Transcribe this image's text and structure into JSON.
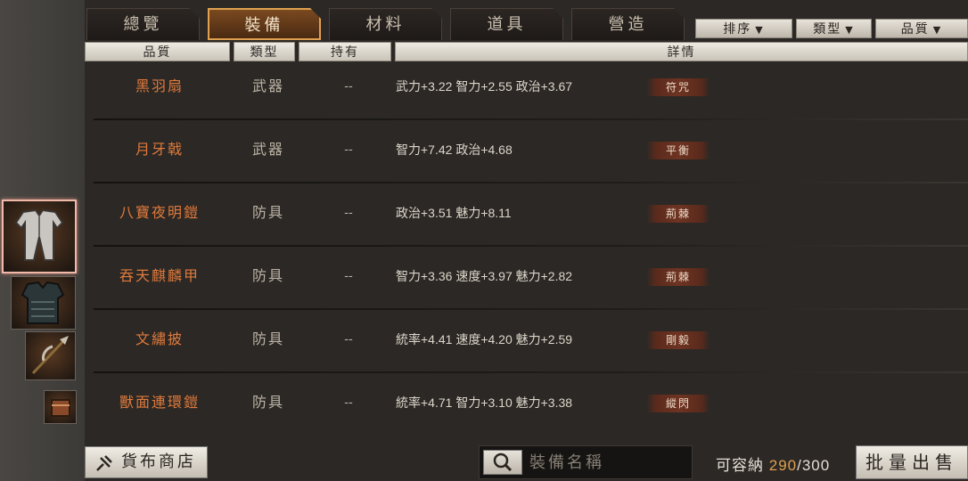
{
  "tabs": [
    {
      "label": "總覽"
    },
    {
      "label": "裝備"
    },
    {
      "label": "材料"
    },
    {
      "label": "道具"
    },
    {
      "label": "營造"
    }
  ],
  "active_tab": "裝備",
  "sort_buttons": {
    "sort": "排序",
    "type": "類型",
    "quality": "品質",
    "arrow": "▼"
  },
  "columns": {
    "quality": "品質",
    "type": "類型",
    "owned": "持有",
    "details": "詳情"
  },
  "items": [
    {
      "name": "黑羽扇",
      "type": "武器",
      "owned": "--",
      "stats": "武力+3.22 智力+2.55 政治+3.67",
      "trait": "符咒"
    },
    {
      "name": "月牙戟",
      "type": "武器",
      "owned": "--",
      "stats": "智力+7.42 政治+4.68",
      "trait": "平衡"
    },
    {
      "name": "八寶夜明鎧",
      "type": "防具",
      "owned": "--",
      "stats": "政治+3.51 魅力+8.11",
      "trait": "荊棘"
    },
    {
      "name": "吞天麒麟甲",
      "type": "防具",
      "owned": "--",
      "stats": "智力+3.36 速度+3.97 魅力+2.82",
      "trait": "荊棘"
    },
    {
      "name": "文繡披",
      "type": "防具",
      "owned": "--",
      "stats": "統率+4.41 速度+4.20 魅力+2.59",
      "trait": "剛毅"
    },
    {
      "name": "獸面連環鎧",
      "type": "防具",
      "owned": "--",
      "stats": "統率+4.71 智力+3.10 魅力+3.38",
      "trait": "縱閃"
    }
  ],
  "footer": {
    "shop_label": "貨布商店",
    "search_placeholder": "裝備名稱",
    "capacity_label": "可容納",
    "capacity_current": "290",
    "capacity_max": "/300",
    "sell_label": "批量出售"
  },
  "icons": {
    "shop": "coin-icon",
    "search": "magnifier-icon"
  },
  "colors": {
    "accent": "#e0a050",
    "item_name": "#e07a3c",
    "trait_badge": "#6e3322"
  }
}
